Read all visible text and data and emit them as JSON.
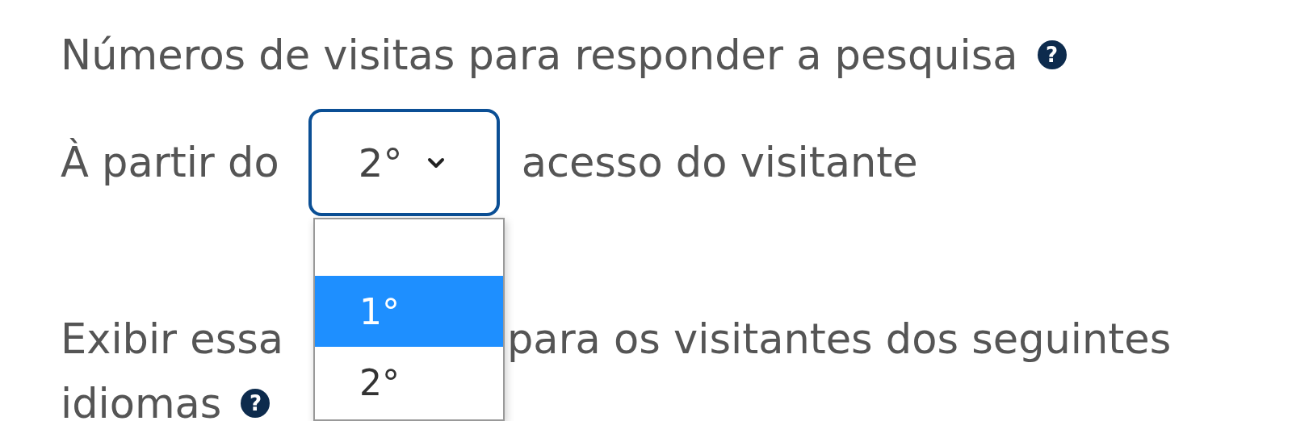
{
  "question": {
    "label": "Números de visitas para responder a pesquisa",
    "help": "?"
  },
  "visit_row": {
    "prefix": "À partir do",
    "select": {
      "value": "2°",
      "open": true
    },
    "suffix": "acesso do visitante"
  },
  "dropdown": {
    "options": [
      {
        "label": "1°",
        "selected": true
      },
      {
        "label": "2°",
        "selected": false
      }
    ]
  },
  "languages": {
    "before": "Exibir essa",
    "after": "para os visitantes dos seguintes",
    "second_line": "idiomas",
    "help": "?"
  }
}
